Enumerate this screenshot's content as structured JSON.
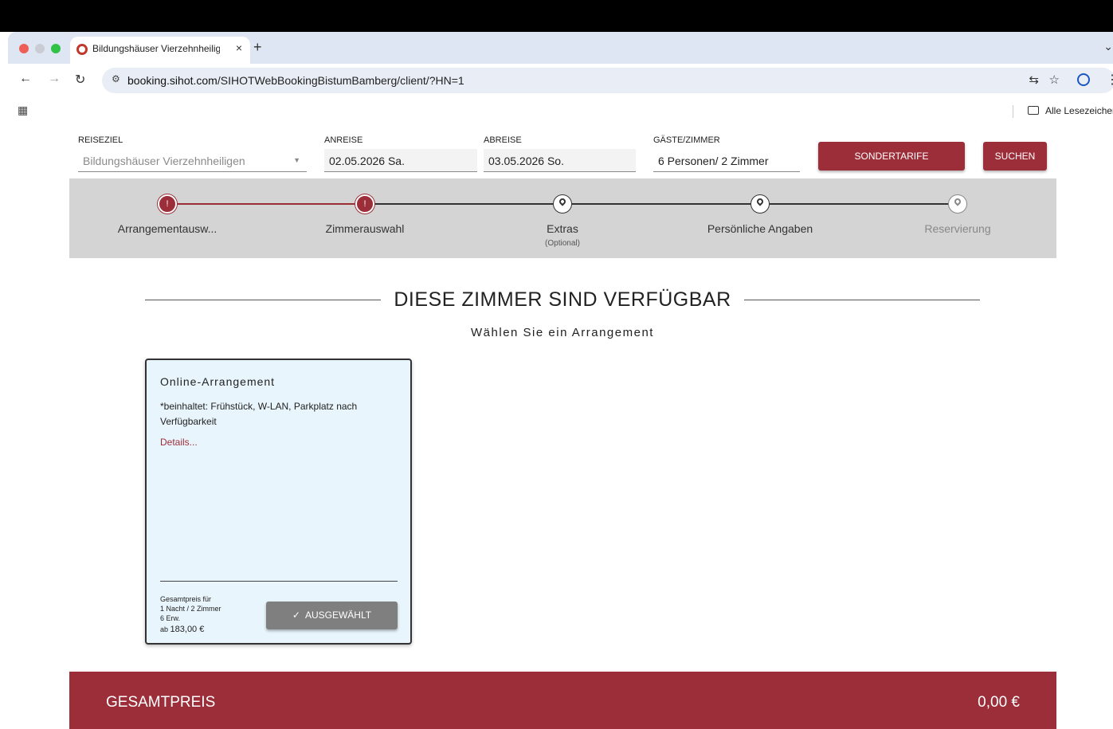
{
  "browser": {
    "tab_title": "Bildungshäuser Vierzehnheilig",
    "tab_close": "×",
    "new_tab": "+",
    "tab_menu": "⌄",
    "url_domain": "booking.sihot.com",
    "url_path": "/SIHOTWebBookingBistumBamberg/client/?HN=1",
    "bookmarks_label": "Alle Lesezeichen"
  },
  "search": {
    "destination_label": "REISEZIEL",
    "destination_value": "Bildungshäuser Vierzehnheiligen",
    "arrival_label": "ANREISE",
    "arrival_value": "02.05.2026 Sa.",
    "departure_label": "ABREISE",
    "departure_value": "03.05.2026 So.",
    "guests_label": "GÄSTE/ZIMMER",
    "guests_value": "6 Personen/ 2 Zimmer",
    "special_rates_button": "SONDERTARIFE",
    "search_button": "SUCHEN"
  },
  "steps": [
    {
      "label": "Arrangementausw...",
      "state": "done"
    },
    {
      "label": "Zimmerauswahl",
      "state": "active"
    },
    {
      "label": "Extras",
      "sub": "(Optional)",
      "state": "pending"
    },
    {
      "label": "Persönliche Angaben",
      "state": "pending"
    },
    {
      "label": "Reservierung",
      "state": "disabled"
    }
  ],
  "main": {
    "heading": "DIESE ZIMMER SIND VERFÜGBAR",
    "subheading": "Wählen Sie ein Arrangement"
  },
  "card": {
    "title": "Online-Arrangement",
    "description": "*beinhaltet: Frühstück, W-LAN, Parkplatz nach Verfügbarkeit",
    "details_link": "Details...",
    "price_label_1": "Gesamtpreis für",
    "price_label_2": "1 Nacht / 2 Zimmer",
    "price_label_3": "6 Erw.",
    "price_prefix": "ab",
    "price_value": "183,00 €",
    "selected_button": "AUSGEWÄHLT"
  },
  "total": {
    "label": "GESAMTPREIS",
    "value": "0,00 €"
  },
  "colors": {
    "brand": "#9c2e3a",
    "stepper_bg": "#d4d4d4",
    "card_bg": "#e8f5fc"
  }
}
